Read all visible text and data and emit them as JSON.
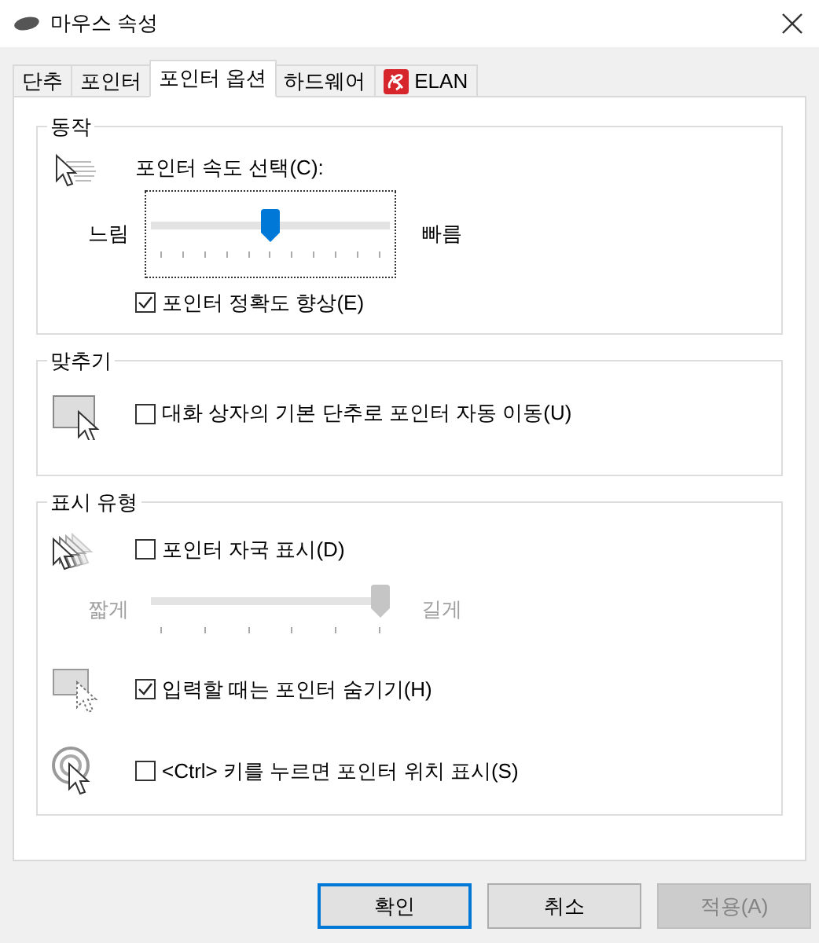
{
  "window": {
    "title": "마우스 속성"
  },
  "tabs": [
    {
      "label": "단추",
      "selected": false,
      "kind": "text"
    },
    {
      "label": "포인터",
      "selected": false,
      "kind": "text"
    },
    {
      "label": "포인터 옵션",
      "selected": true,
      "kind": "text"
    },
    {
      "label": "하드웨어",
      "selected": false,
      "kind": "text"
    },
    {
      "label": "ELAN",
      "selected": false,
      "kind": "logo"
    }
  ],
  "motion": {
    "title": "동작",
    "speed": {
      "label": "포인터 속도 선택(C):",
      "min_label": "느림",
      "max_label": "빠름",
      "level": 0.5,
      "disabled": false,
      "focused": true
    },
    "precision": {
      "label": "포인터 정확도 향상(E)",
      "checked": true
    }
  },
  "snap_to": {
    "title": "맞추기",
    "snap": {
      "label": "대화 상자의 기본 단추로 포인터 자동 이동(U)",
      "checked": false
    }
  },
  "visibility": {
    "title": "표시 유형",
    "trails": {
      "label": "포인터 자국 표시(D)",
      "checked": false
    },
    "trail_length": {
      "min_label": "짧게",
      "max_label": "길게",
      "level": 1,
      "disabled": true,
      "focused": false
    },
    "hide_typing": {
      "label": "입력할 때는 포인터 숨기기(H)",
      "checked": true
    },
    "ctrl_location": {
      "label": "<Ctrl> 키를 누르면 포인터 위치 표시(S)",
      "checked": false
    }
  },
  "buttons": [
    {
      "label": "확인",
      "default": true,
      "disabled": false
    },
    {
      "label": "취소",
      "default": false,
      "disabled": false
    },
    {
      "label": "적용(A)",
      "default": false,
      "disabled": true
    }
  ]
}
